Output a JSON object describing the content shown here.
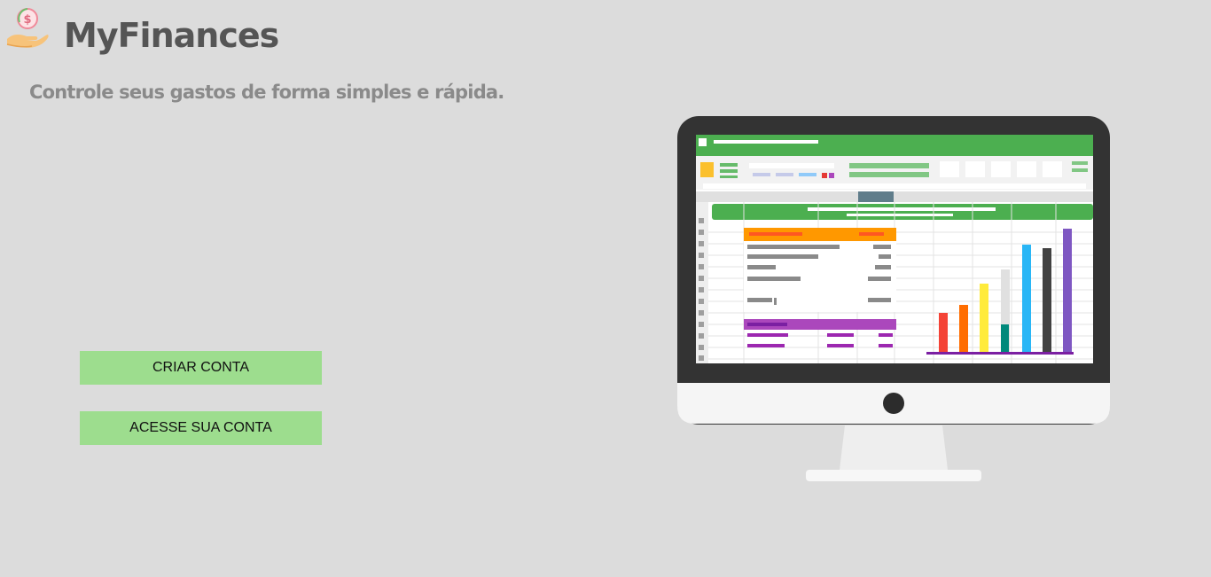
{
  "brand": {
    "name": "MyFinances",
    "logo_icon": "hand-coin-icon"
  },
  "tagline": "Controle seus gastos de forma simples e rápida.",
  "actions": {
    "create_account_label": "CRIAR CONTA",
    "login_label": "ACESSE SUA CONTA"
  },
  "illustration": {
    "icon": "monitor-spreadsheet-icon"
  },
  "colors": {
    "background": "#dcdcdc",
    "button": "#9ddd8e",
    "title": "#555555",
    "tagline": "#8a8a8a",
    "spreadsheet_green": "#4caf50"
  }
}
